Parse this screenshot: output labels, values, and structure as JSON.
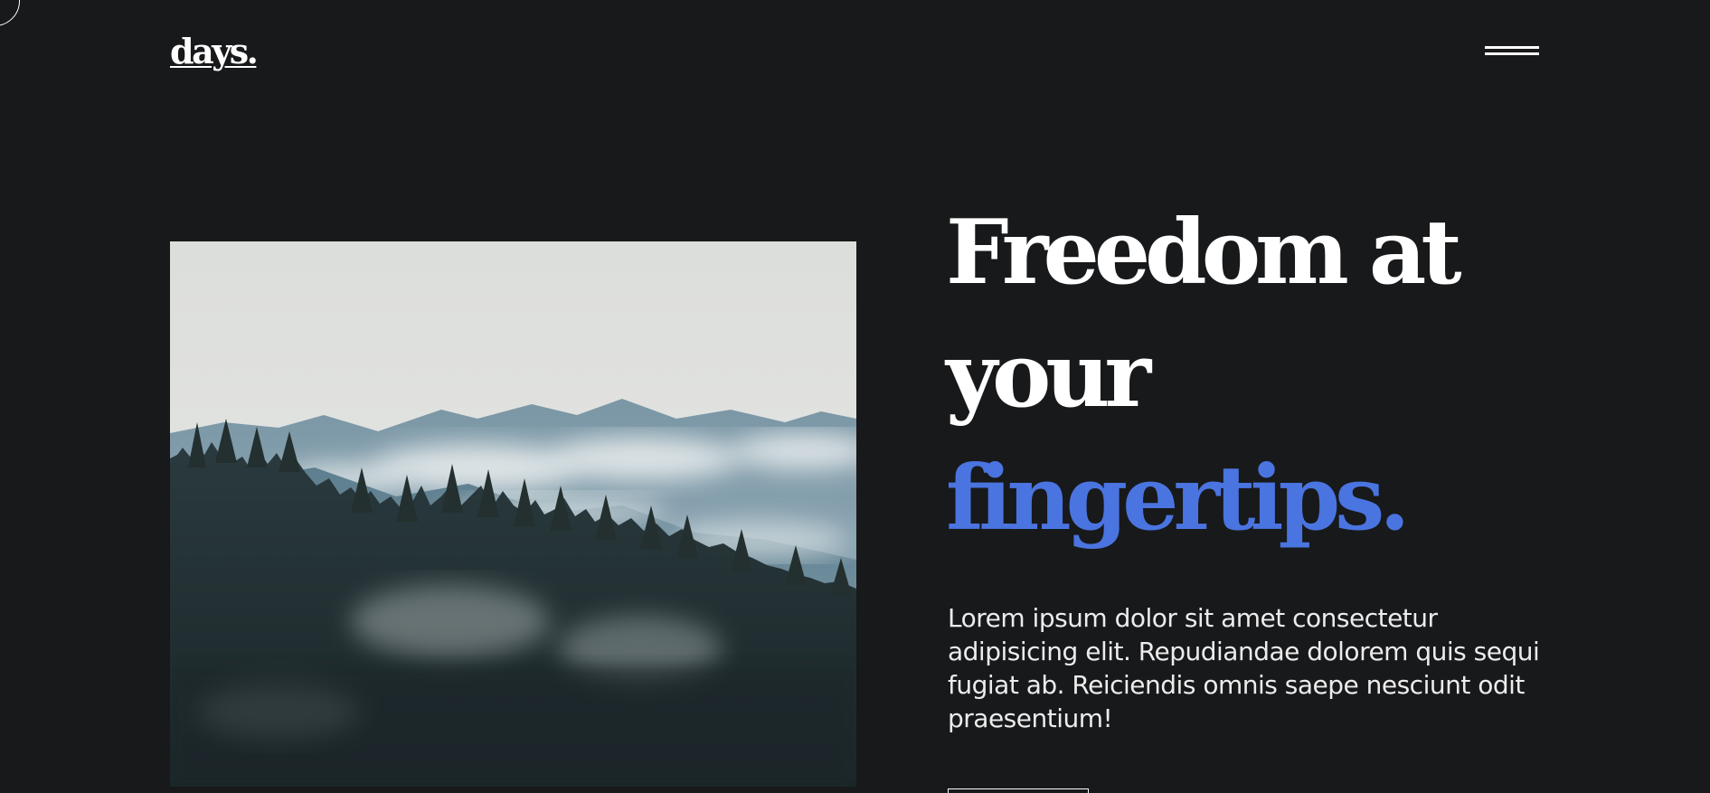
{
  "header": {
    "logo_text": "days.",
    "menu_icon": "hamburger-menu-icon"
  },
  "hero": {
    "image_icon": "misty-forest-mountains-photo",
    "headline_line_1": "Freedom at",
    "headline_line_2": "your",
    "headline_line_3": "fingertips.",
    "description": "Lorem ipsum dolor sit amet consectetur adipisicing elit. Repudiandae dolorem quis sequi fugiat ab. Reiciendis omnis saepe nesciunt odit praesentium!"
  },
  "colors": {
    "background": "#18191b",
    "text": "#ffffff",
    "accent": "#4a74e0"
  }
}
